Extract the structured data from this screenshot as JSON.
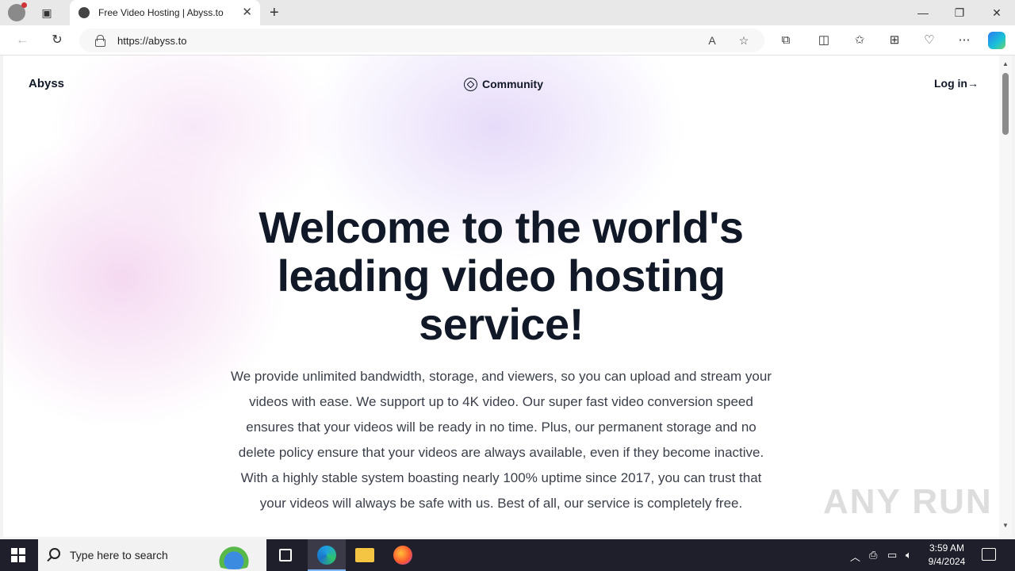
{
  "browser": {
    "tab_title": "Free Video Hosting | Abyss.to",
    "url": "https://abyss.to"
  },
  "page": {
    "brand": "Abyss",
    "nav_community": "Community",
    "nav_login": "Log in→",
    "hero_title": "Welcome to the world's leading video hosting service!",
    "hero_description": "We provide unlimited bandwidth, storage, and viewers, so you can upload and stream your videos with ease. We support up to 4K video. Our super fast video conversion speed ensures that your videos will be ready in no time. Plus, our permanent storage and no delete policy ensure that your videos are always available, even if they become inactive. With a highly stable system boasting nearly 100% uptime since 2017, you can trust that your videos will always be safe with us. Best of all, our service is completely free."
  },
  "watermark": "ANY RUN",
  "taskbar": {
    "search_placeholder": "Type here to search",
    "time": "3:59 AM",
    "date": "9/4/2024"
  }
}
